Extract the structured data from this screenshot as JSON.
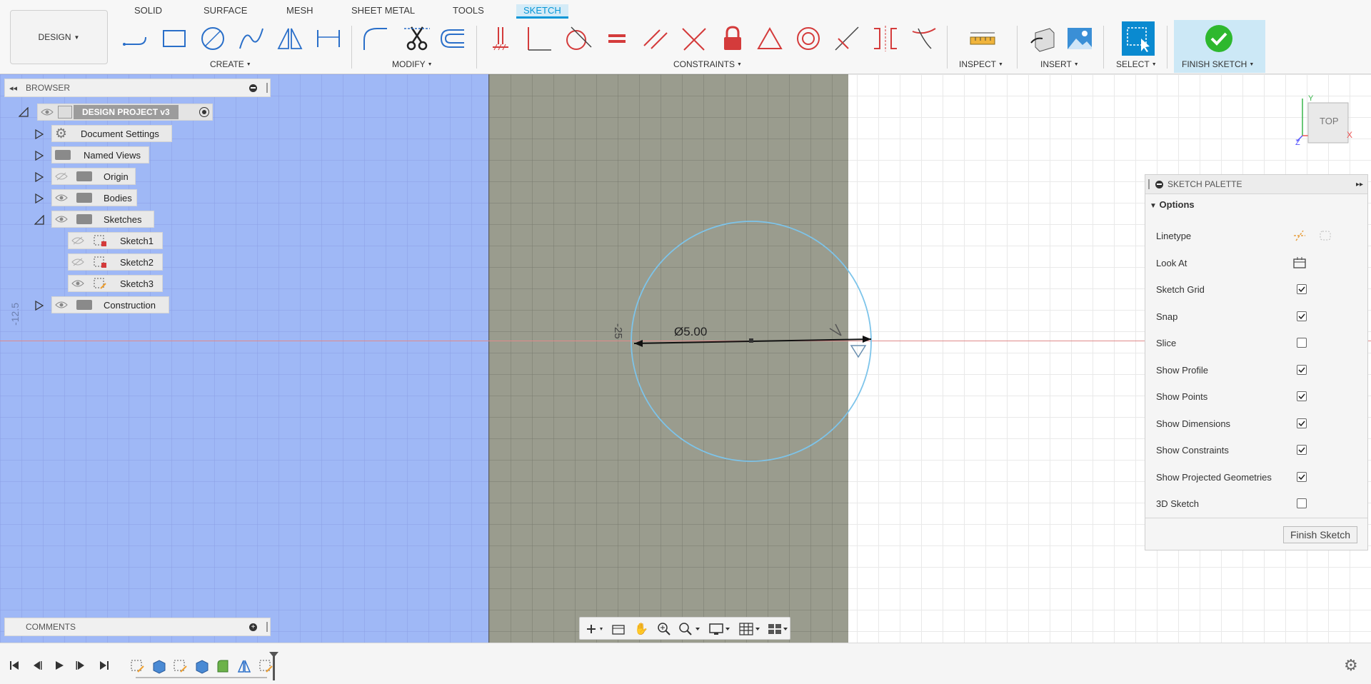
{
  "workspace_button": {
    "label": "DESIGN"
  },
  "tabs": [
    {
      "label": "SOLID"
    },
    {
      "label": "SURFACE"
    },
    {
      "label": "MESH"
    },
    {
      "label": "SHEET METAL"
    },
    {
      "label": "TOOLS"
    },
    {
      "label": "SKETCH",
      "active": true
    }
  ],
  "groups": {
    "create": "CREATE",
    "modify": "MODIFY",
    "constraints": "CONSTRAINTS",
    "inspect": "INSPECT",
    "insert": "INSERT",
    "select": "SELECT",
    "finish_sketch": "FINISH SKETCH"
  },
  "browser": {
    "title": "BROWSER",
    "root": "DESIGN PROJECT v3",
    "items": [
      {
        "label": "Document Settings",
        "icon": "gear-icon"
      },
      {
        "label": "Named Views",
        "icon": "folder-icon"
      },
      {
        "label": "Origin",
        "icon": "folder-icon"
      },
      {
        "label": "Bodies",
        "icon": "folder-icon"
      },
      {
        "label": "Sketches",
        "icon": "folder-icon"
      },
      {
        "label": "Sketch1",
        "icon": "sketch-icon"
      },
      {
        "label": "Sketch2",
        "icon": "sketch-icon"
      },
      {
        "label": "Sketch3",
        "icon": "sketch-icon"
      },
      {
        "label": "Construction",
        "icon": "folder-icon"
      }
    ]
  },
  "comments": {
    "title": "COMMENTS"
  },
  "canvas": {
    "coord_left": "-12.5",
    "coord_near_circle": "-25",
    "dimension": "Ø5.00",
    "viewcube": {
      "face": "TOP",
      "axis_x": "X",
      "axis_y": "Y",
      "axis_z": "Z"
    }
  },
  "palette": {
    "title": "SKETCH PALETTE",
    "section": "Options",
    "rows": [
      {
        "label": "Linetype",
        "type": "icons"
      },
      {
        "label": "Look At",
        "type": "icon"
      },
      {
        "label": "Sketch Grid",
        "checked": true
      },
      {
        "label": "Snap",
        "checked": true
      },
      {
        "label": "Slice",
        "checked": false
      },
      {
        "label": "Show Profile",
        "checked": true
      },
      {
        "label": "Show Points",
        "checked": true
      },
      {
        "label": "Show Dimensions",
        "checked": true
      },
      {
        "label": "Show Constraints",
        "checked": true
      },
      {
        "label": "Show Projected Geometries",
        "checked": true
      },
      {
        "label": "3D Sketch",
        "checked": false
      }
    ],
    "finish_button": "Finish Sketch"
  },
  "colors": {
    "accent": "#0696d7",
    "blue_region": "#9fb8f6",
    "gray_region": "#9a9c8e",
    "circle": "#7dc4ea",
    "finish_green": "#2eb82e"
  }
}
